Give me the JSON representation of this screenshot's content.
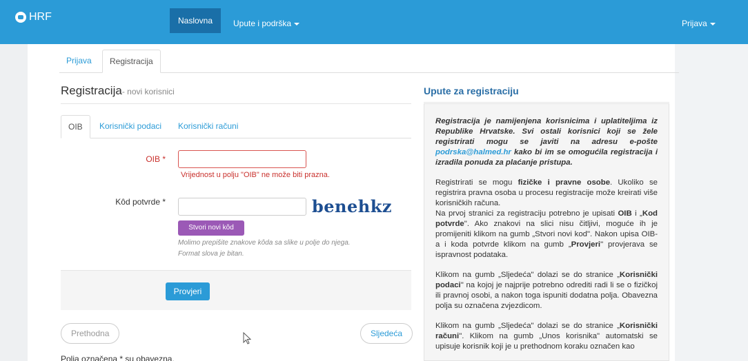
{
  "navbar": {
    "brand": "HRF",
    "items": [
      {
        "label": "Naslovna",
        "active": true
      },
      {
        "label": "Upute i podrška",
        "dropdown": true
      }
    ],
    "user_menu": "Prijava"
  },
  "top_tabs": [
    {
      "label": "Prijava",
      "active": false
    },
    {
      "label": "Registracija",
      "active": true
    }
  ],
  "form": {
    "title": "Registracija",
    "subtitle": "- novi korisnici",
    "tabs": [
      {
        "label": "OIB",
        "active": true
      },
      {
        "label": "Korisnički podaci",
        "active": false
      },
      {
        "label": "Korisnički računi",
        "active": false
      }
    ],
    "oib_label": "OIB *",
    "oib_value": "",
    "oib_error": "Vrijednost u polju \"OIB\" ne može biti prazna.",
    "code_label": "Kôd potvrde *",
    "code_value": "",
    "captcha_text": "benehkz",
    "new_code_button": "Stvori novi kôd",
    "help_line1": "Molimo prepišite znakove kôda sa slike u polje do njega.",
    "help_line2": "Format slova je bitan.",
    "check_button": "Provjeri",
    "prev_button": "Prethodna",
    "next_button": "Sljedeća",
    "required_note": "Polja označena * su obavezna."
  },
  "guide": {
    "title": "Upute za registraciju",
    "intro_a": "Registracija je namijenjena korisnicima i uplatiteljima iz Republike Hrvatske. Svi ostali korisnici koji se žele registrirati mogu se javiti na adresu e-pošte ",
    "intro_email": "podrska@halmed.hr",
    "intro_b": " kako bi im se omogućila registracija i izradila ponuda za plaćanje pristupa.",
    "p2_a": "Registrirati se mogu ",
    "p2_b": "fizičke i pravne osobe",
    "p2_c": ". Ukoliko se registrira pravna osoba u procesu registracije može kreirati više korisničkih računa.",
    "p2_d": "Na prvoj stranici za registraciju potrebno je upisati ",
    "p2_e": "OIB",
    "p2_f": " i „",
    "p2_g": "Kod potvrde",
    "p2_h": "\". Ako znakovi na slici nisu čitljivi, moguće ih je promijeniti klikom na gumb „Stvori novi kod\". Nakon upisa OIB-a i koda potvrde klikom na gumb „",
    "p2_i": "Provjeri",
    "p2_j": "\" provjerava se ispravnost podataka.",
    "p3_a": "Klikom na gumb „Sljedeća\" dolazi se do stranice „",
    "p3_b": "Korisnički podaci",
    "p3_c": "\" na kojoj je najprije potrebno odrediti radi li se o fizičkoj ili pravnoj osobi, a nakon toga ispuniti dodatna polja. Obavezna polja su označena zvjezdicom.",
    "p4_a": "Klikom na gumb „Sljedeća\" dolazi se do stranice „",
    "p4_b": "Korisnički računi",
    "p4_c": "\". Klikom na gumb „Unos korisnika\" automatski se upisuje korisnik koji je u prethodnom koraku označen kao"
  }
}
